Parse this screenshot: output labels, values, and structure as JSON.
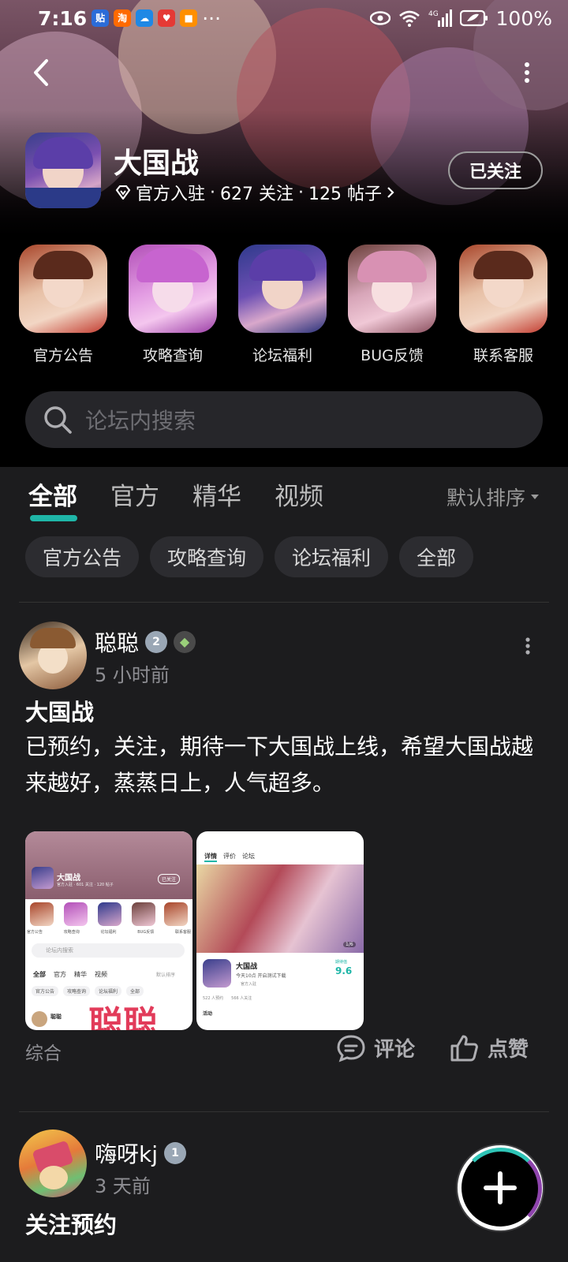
{
  "status_bar": {
    "time": "7:16",
    "battery": "100%",
    "network": "4G"
  },
  "header": {
    "forum_name": "大国战",
    "verified_label": "官方入驻",
    "follows": "627 关注",
    "posts": "125 帖子",
    "follow_button": "已关注"
  },
  "shortcuts": [
    {
      "label": "官方公告"
    },
    {
      "label": "攻略查询"
    },
    {
      "label": "论坛福利"
    },
    {
      "label": "BUG反馈"
    },
    {
      "label": "联系客服"
    }
  ],
  "search": {
    "placeholder": "论坛内搜索"
  },
  "tabs": [
    {
      "label": "全部",
      "active": true
    },
    {
      "label": "官方"
    },
    {
      "label": "精华"
    },
    {
      "label": "视频"
    }
  ],
  "sort": {
    "label": "默认排序"
  },
  "chips": [
    {
      "label": "官方公告"
    },
    {
      "label": "攻略查询"
    },
    {
      "label": "论坛福利"
    },
    {
      "label": "全部"
    }
  ],
  "posts": [
    {
      "author": "聪聪",
      "level": "2",
      "time": "5 小时前",
      "title": "大国战",
      "body": "已预约，关注，期待一下大国战上线，希望大国战越来越好，蒸蒸日上，人气超多。",
      "category": "综合",
      "comment_label": "评论",
      "like_label": "点赞"
    },
    {
      "author": "嗨呀kj",
      "level": "1",
      "time": "3 天前",
      "title": "关注预约"
    }
  ],
  "thumb1": {
    "forum_name": "大国战",
    "stats": "官方入驻 · 601 关注 · 120 帖子",
    "follow_button": "已关注",
    "search_placeholder": "论坛内搜索",
    "tabs": [
      "全部",
      "官方",
      "精华",
      "视频"
    ],
    "sort": "默认排序",
    "chips": [
      "官方公告",
      "攻略查询",
      "论坛福利",
      "全部"
    ],
    "shortcuts": [
      "官方公告",
      "攻略查询",
      "论坛福利",
      "BUG反馈",
      "联系客服"
    ],
    "author": "聪聪",
    "watermark": "聪聪"
  },
  "thumb2": {
    "tabs": [
      "详情",
      "评价",
      "论坛"
    ],
    "game_name": "大国战",
    "launch_note": "今天10点 开启测试下载",
    "verified": "官方入驻",
    "score_label": "期待值",
    "score": "9.6",
    "reservations": "522 人预约",
    "follows": "566 人关注",
    "activity": "活动",
    "page_indicator": "1/6"
  },
  "colors": {
    "accent": "#1fb6a8",
    "background": "#1c1c1e",
    "header_background": "#000000"
  },
  "icons": {
    "back": "chevron-left-icon",
    "more": "more-vertical-icon",
    "verified": "diamond-icon",
    "search": "search-icon",
    "comment": "comment-icon",
    "like": "thumbs-up-icon",
    "fab": "plus-icon"
  }
}
